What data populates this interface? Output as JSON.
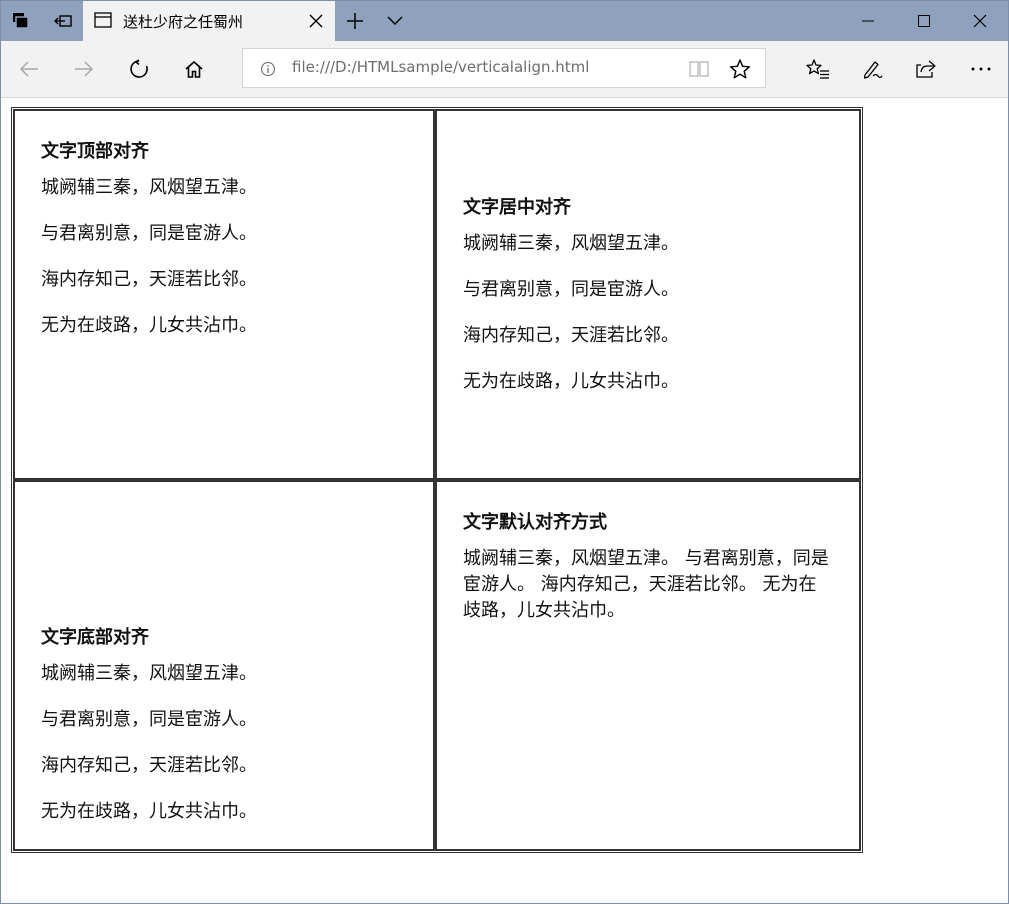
{
  "browser": {
    "tab_title": "送杜少府之任蜀州",
    "address_url": "file:///D:/HTMLsample/verticalalign.html",
    "icons": {
      "tab_set_aside": "tabs-icon",
      "tab_preview": "set-aside-tabs-icon",
      "new_tab": "plus-icon",
      "tab_list": "chevron-down-icon",
      "minimize": "minimize-icon",
      "maximize": "maximize-icon",
      "close": "close-icon",
      "back": "back-arrow-icon",
      "forward": "forward-arrow-icon",
      "refresh": "refresh-icon",
      "home": "home-icon",
      "info": "info-icon",
      "reading_view": "book-icon",
      "favorite": "star-icon",
      "favorites_hub": "favorites-list-icon",
      "notes": "pen-icon",
      "share": "share-icon",
      "more": "more-icon"
    }
  },
  "page": {
    "cells": [
      {
        "heading": "文字顶部对齐",
        "lines": [
          "城阙辅三秦，风烟望五津。",
          "与君离别意，同是宦游人。",
          "海内存知己，天涯若比邻。",
          "无为在歧路，儿女共沾巾。"
        ]
      },
      {
        "heading": "文字居中对齐",
        "lines": [
          "城阙辅三秦，风烟望五津。",
          "与君离别意，同是宦游人。",
          "海内存知己，天涯若比邻。",
          "无为在歧路，儿女共沾巾。"
        ]
      },
      {
        "heading": "文字底部对齐",
        "lines": [
          "城阙辅三秦，风烟望五津。",
          "与君离别意，同是宦游人。",
          "海内存知己，天涯若比邻。",
          "无为在歧路，儿女共沾巾。"
        ]
      },
      {
        "heading": "文字默认对齐方式",
        "text": "城阙辅三秦，风烟望五津。 与君离别意，同是宦游人。 海内存知己，天涯若比邻。 无为在歧路，儿女共沾巾。"
      }
    ]
  }
}
